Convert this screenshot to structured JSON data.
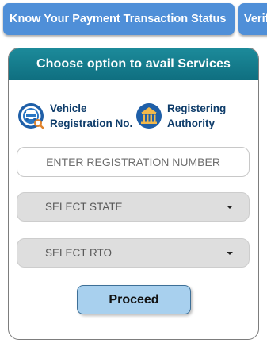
{
  "top_tabs": [
    {
      "label": "Know Your Payment Transaction Status"
    },
    {
      "label": "Verify"
    }
  ],
  "card": {
    "title": "Choose option to avail Services",
    "options": [
      {
        "label": "Vehicle\nRegistration No.",
        "icon": "vehicle-registration-icon"
      },
      {
        "label": "Registering\nAuthority",
        "icon": "registering-authority-icon"
      }
    ],
    "registration_input": {
      "placeholder": "ENTER REGISTRATION NUMBER",
      "value": ""
    },
    "state_select": {
      "selected": "SELECT STATE"
    },
    "rto_select": {
      "selected": "SELECT RTO"
    },
    "proceed_label": "Proceed"
  },
  "colors": {
    "tab_blue": "#4f8fd8",
    "header_teal": "#0f6f80",
    "label_navy": "#0e3c6a",
    "button_blue": "#a8d0ee"
  }
}
